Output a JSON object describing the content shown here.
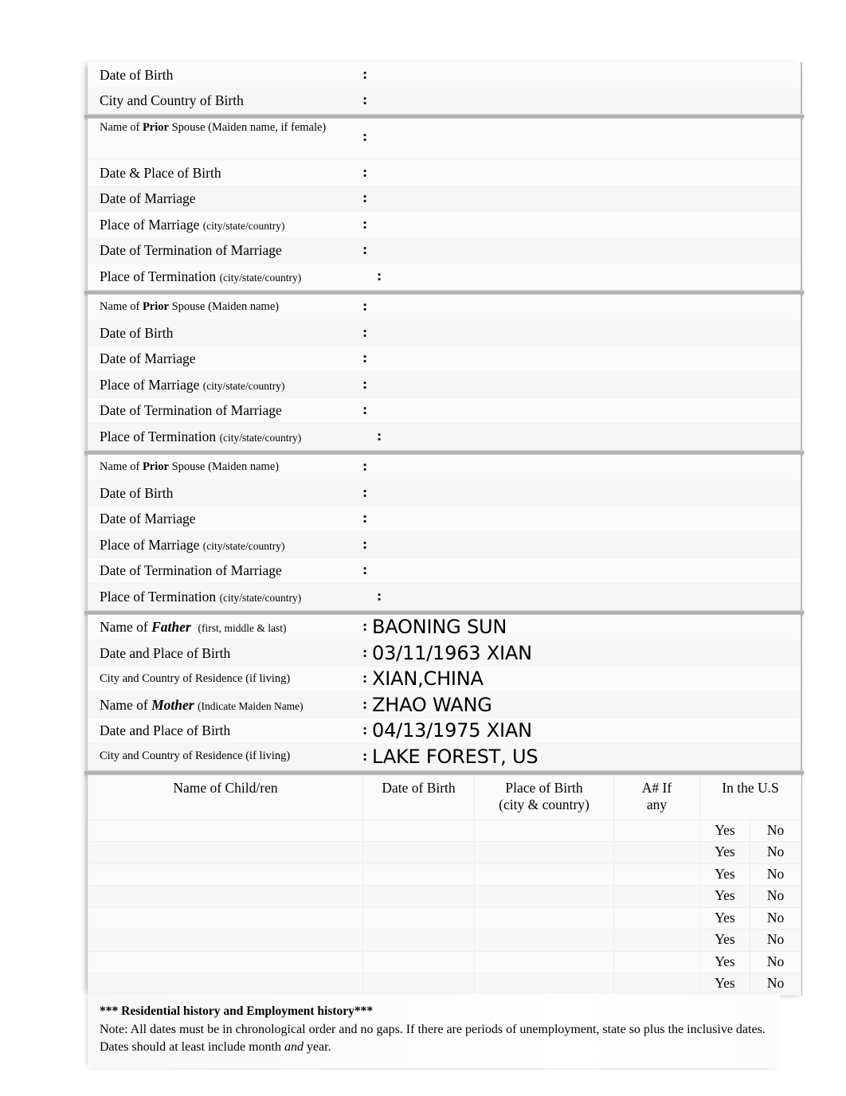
{
  "document": {
    "kind": "immigration-biographic-information-form"
  },
  "sections": {
    "applicant": {
      "rows": [
        {
          "label_prefix": "Date of Birth",
          "label_paren": "",
          "colon": ":",
          "value": ""
        },
        {
          "label_prefix": "City and Country of Birth",
          "label_paren": "",
          "colon": ":",
          "value": ""
        }
      ]
    },
    "prior_spouse_1": {
      "rows": [
        {
          "label_prefix": "Name of ",
          "label_bold": "Prior",
          "label_suffix": " Spouse (Maiden name, if female)",
          "colon": ":",
          "value": ""
        },
        {
          "label_prefix": "Date & Place of Birth",
          "label_paren": "",
          "colon": ":",
          "value": ""
        },
        {
          "label_prefix": "Date of Marriage",
          "label_paren": "",
          "colon": ":",
          "value": ""
        },
        {
          "label_prefix": "Place of Marriage ",
          "label_paren": "(city/state/country)",
          "colon": ":",
          "value": ""
        },
        {
          "label_prefix": "Date of Termination of Marriage",
          "label_paren": "",
          "colon": ":",
          "value": ""
        },
        {
          "label_prefix": "Place of Termination ",
          "label_paren": "(city/state/country)",
          "colon": ":",
          "value": ""
        }
      ]
    },
    "prior_spouse_2": {
      "rows": [
        {
          "label_prefix": "Name of ",
          "label_bold": "Prior",
          "label_suffix": " Spouse (Maiden name)",
          "colon": ":",
          "value": ""
        },
        {
          "label_prefix": "Date of Birth",
          "label_paren": "",
          "colon": ":",
          "value": ""
        },
        {
          "label_prefix": "Date of Marriage",
          "label_paren": "",
          "colon": ":",
          "value": ""
        },
        {
          "label_prefix": "Place of Marriage ",
          "label_paren": "(city/state/country)",
          "colon": ":",
          "value": ""
        },
        {
          "label_prefix": "Date of Termination of Marriage",
          "label_paren": "",
          "colon": ":",
          "value": ""
        },
        {
          "label_prefix": "Place of Termination ",
          "label_paren": "(city/state/country)",
          "colon": ":",
          "value": ""
        }
      ]
    },
    "prior_spouse_3": {
      "rows": [
        {
          "label_prefix": "Name of ",
          "label_bold": "Prior",
          "label_suffix": " Spouse (Maiden name)",
          "colon": ":",
          "value": ""
        },
        {
          "label_prefix": "Date of Birth",
          "label_paren": "",
          "colon": ":",
          "value": ""
        },
        {
          "label_prefix": "Date of Marriage",
          "label_paren": "",
          "colon": ":",
          "value": ""
        },
        {
          "label_prefix": "Place of Marriage ",
          "label_paren": "(city/state/country)",
          "colon": ":",
          "value": ""
        },
        {
          "label_prefix": "Date of Termination of Marriage",
          "label_paren": "",
          "colon": ":",
          "value": ""
        },
        {
          "label_prefix": "Place of Termination ",
          "label_paren": "(city/state/country)",
          "colon": ":",
          "value": ""
        }
      ]
    },
    "parents": {
      "father_name": {
        "label_prefix": "Name of ",
        "label_emph": "Father",
        "label_paren": "(first, middle & last)",
        "colon": ":",
        "value": "BAONING SUN"
      },
      "father_dob": {
        "label_prefix": "Date and Place of Birth",
        "colon": ":",
        "value": "03/11/1963 XIAN"
      },
      "father_residence": {
        "label_prefix": "City and Country of Residence (if living)",
        "colon": ":",
        "value": "XIAN,CHINA"
      },
      "mother_name": {
        "label_prefix": "Name of ",
        "label_emph": "Mother",
        "label_paren": "(Indicate Maiden Name)",
        "colon": ":",
        "value": "ZHAO WANG"
      },
      "mother_dob": {
        "label_prefix": "Date and Place of Birth",
        "colon": ":",
        "value": "04/13/1975 XIAN"
      },
      "mother_residence": {
        "label_prefix": "City and Country of Residence (if living)",
        "colon": ":",
        "value": "LAKE FOREST, US"
      }
    }
  },
  "children_table": {
    "headers": {
      "name": "Name of Child/ren",
      "dob": "Date of Birth",
      "pob_line1": "Place of Birth",
      "pob_line2": "(city & country)",
      "anum_line1": "A# If",
      "anum_line2": "any",
      "in_us": "In the U.S"
    },
    "yes_label": "Yes",
    "no_label": "No",
    "rows": [
      {
        "name": "",
        "dob": "",
        "pob": "",
        "anum": "",
        "yes": "Yes",
        "no": "No"
      },
      {
        "name": "",
        "dob": "",
        "pob": "",
        "anum": "",
        "yes": "Yes",
        "no": "No"
      },
      {
        "name": "",
        "dob": "",
        "pob": "",
        "anum": "",
        "yes": "Yes",
        "no": "No"
      },
      {
        "name": "",
        "dob": "",
        "pob": "",
        "anum": "",
        "yes": "Yes",
        "no": "No"
      },
      {
        "name": "",
        "dob": "",
        "pob": "",
        "anum": "",
        "yes": "Yes",
        "no": "No"
      },
      {
        "name": "",
        "dob": "",
        "pob": "",
        "anum": "",
        "yes": "Yes",
        "no": "No"
      },
      {
        "name": "",
        "dob": "",
        "pob": "",
        "anum": "",
        "yes": "Yes",
        "no": "No"
      },
      {
        "name": "",
        "dob": "",
        "pob": "",
        "anum": "",
        "yes": "Yes",
        "no": "No"
      }
    ]
  },
  "footer_note": {
    "title": "*** Residential history and Employment history***",
    "body_part1": "Note: All dates must be in chronological order and no gaps.  If there are periods of unemployment, state so plus the inclusive dates.  Dates should at least include month ",
    "body_italic": "and",
    "body_part2": " year."
  }
}
